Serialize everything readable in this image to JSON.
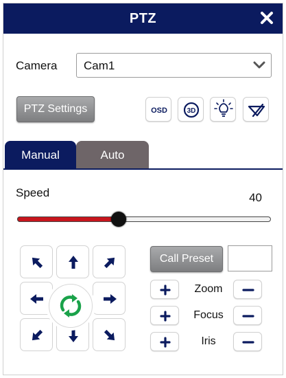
{
  "window": {
    "title": "PTZ"
  },
  "camera": {
    "label": "Camera",
    "selected": "Cam1"
  },
  "toolbar": {
    "ptz_settings_label": "PTZ Settings",
    "osd_label": "OSD",
    "threed_label": "3D"
  },
  "tabs": [
    {
      "label": "Manual",
      "active": true
    },
    {
      "label": "Auto",
      "active": false
    }
  ],
  "speed": {
    "label": "Speed",
    "value": "40",
    "fraction": 0.4
  },
  "preset": {
    "call_label": "Call Preset",
    "value": ""
  },
  "lens": {
    "zoom_label": "Zoom",
    "focus_label": "Focus",
    "iris_label": "Iris"
  },
  "colors": {
    "header": "#0b1b5f",
    "tab_inactive": "#6e6568",
    "slider_fill": "#c8161d",
    "rotate_icon": "#1aa24a"
  }
}
